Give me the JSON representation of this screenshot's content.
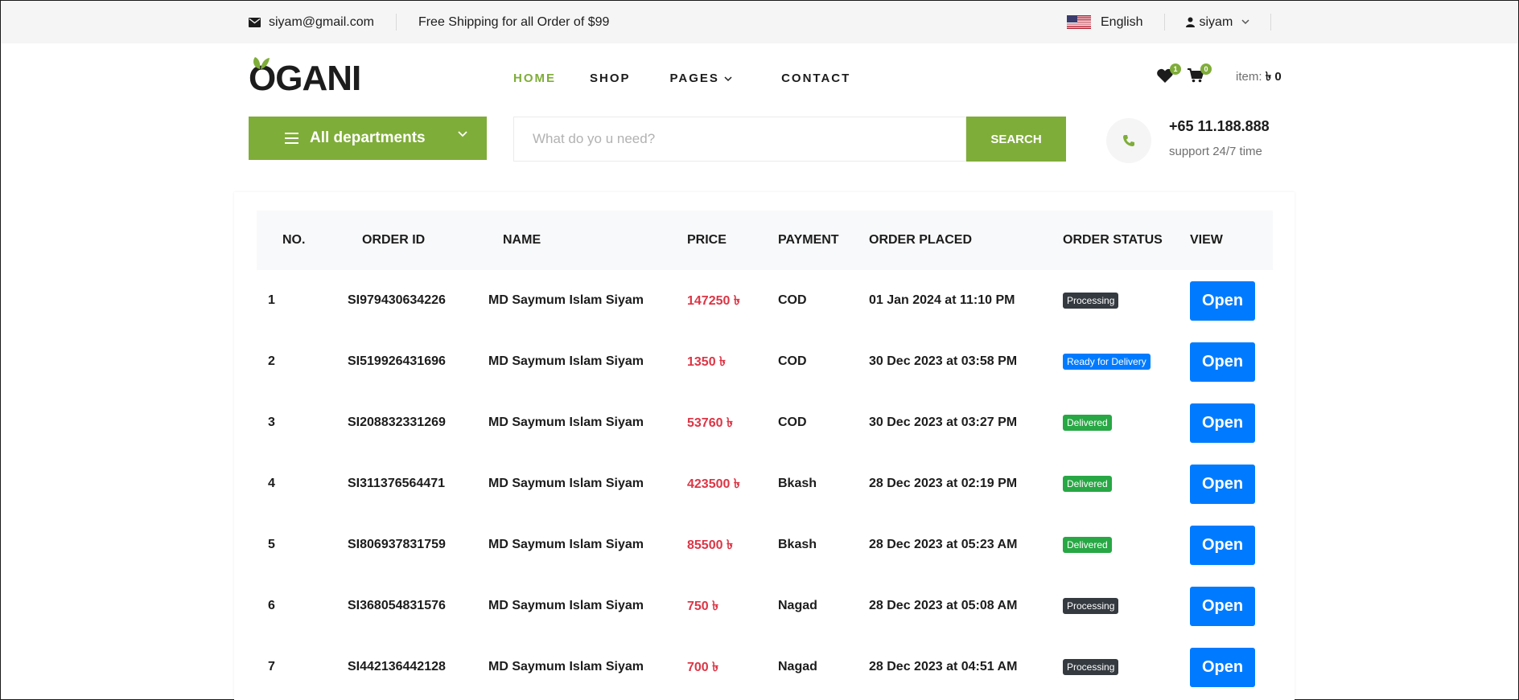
{
  "topbar": {
    "email": "siyam@gmail.com",
    "shipping": "Free Shipping for all Order of $99",
    "language": "English",
    "user": "siyam"
  },
  "header": {
    "logo": "OGANI",
    "nav": [
      "HOME",
      "SHOP",
      "PAGES",
      "CONTACT"
    ],
    "wishlist_count": "1",
    "cart_count": "0",
    "item_label": "item:",
    "item_total": "৳ 0"
  },
  "hero": {
    "departments_label": "All departments",
    "search_placeholder": "What do yo u need?",
    "search_button": "SEARCH",
    "phone": "+65 11.188.888",
    "support": "support 24/7 time"
  },
  "orders": {
    "headers": [
      "NO.",
      "ORDER ID",
      "NAME",
      "PRICE",
      "PAYMENT",
      "ORDER PLACED",
      "ORDER STATUS",
      "VIEW"
    ],
    "rows": [
      {
        "no": "1",
        "id": "SI979430634226",
        "name": "MD Saymum Islam Siyam",
        "price": "147250 ৳",
        "payment": "COD",
        "placed": "01 Jan 2024 at 11:10 PM",
        "status": "Processing",
        "status_type": "processing",
        "view": "Open"
      },
      {
        "no": "2",
        "id": "SI519926431696",
        "name": "MD Saymum Islam Siyam",
        "price": "1350 ৳",
        "payment": "COD",
        "placed": "30 Dec 2023 at 03:58 PM",
        "status": "Ready for Delivery",
        "status_type": "ready",
        "view": "Open"
      },
      {
        "no": "3",
        "id": "SI208832331269",
        "name": "MD Saymum Islam Siyam",
        "price": "53760 ৳",
        "payment": "COD",
        "placed": "30 Dec 2023 at 03:27 PM",
        "status": "Delivered",
        "status_type": "delivered",
        "view": "Open"
      },
      {
        "no": "4",
        "id": "SI311376564471",
        "name": "MD Saymum Islam Siyam",
        "price": "423500 ৳",
        "payment": "Bkash",
        "placed": "28 Dec 2023 at 02:19 PM",
        "status": "Delivered",
        "status_type": "delivered",
        "view": "Open"
      },
      {
        "no": "5",
        "id": "SI806937831759",
        "name": "MD Saymum Islam Siyam",
        "price": "85500 ৳",
        "payment": "Bkash",
        "placed": "28 Dec 2023 at 05:23 AM",
        "status": "Delivered",
        "status_type": "delivered",
        "view": "Open"
      },
      {
        "no": "6",
        "id": "SI368054831576",
        "name": "MD Saymum Islam Siyam",
        "price": "750 ৳",
        "payment": "Nagad",
        "placed": "28 Dec 2023 at 05:08 AM",
        "status": "Processing",
        "status_type": "processing",
        "view": "Open"
      },
      {
        "no": "7",
        "id": "SI442136442128",
        "name": "MD Saymum Islam Siyam",
        "price": "700 ৳",
        "payment": "Nagad",
        "placed": "28 Dec 2023 at 04:51 AM",
        "status": "Processing",
        "status_type": "processing",
        "view": "Open"
      }
    ]
  },
  "colors": {
    "brand_green": "#7fad39",
    "price_red": "#dc3545",
    "button_blue": "#007bff",
    "processing": "#343a40",
    "ready": "#007bff",
    "delivered": "#28a745"
  },
  "icons": [
    "envelope-icon",
    "us-flag-icon",
    "user-icon",
    "chevron-down-icon",
    "heart-icon",
    "cart-icon",
    "menu-bars-icon",
    "phone-icon"
  ]
}
